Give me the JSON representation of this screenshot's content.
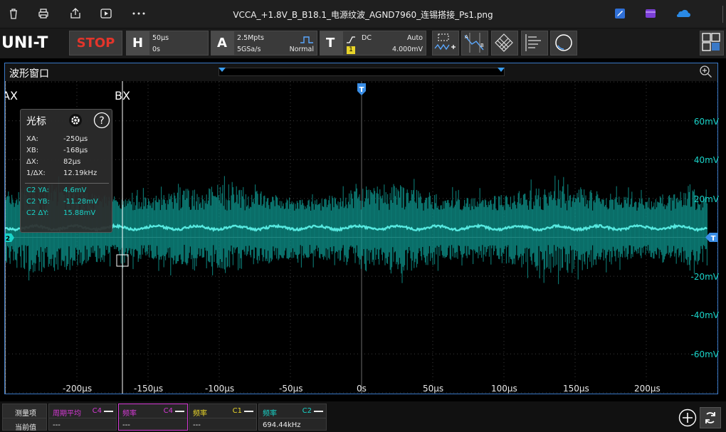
{
  "titlebar": {
    "title": "VCCA_+1.8V_B_B18.1_电源纹波_AGND7960_连锡搭接_Ps1.png",
    "icons": [
      "delete-icon",
      "print-icon",
      "share-icon",
      "slideshow-icon",
      "more-icon",
      "edit-icon",
      "clipchamp-icon",
      "onedrive-icon"
    ]
  },
  "toolbar": {
    "logo": "UNI-T",
    "run_state": "STOP",
    "horizontal": {
      "label": "H",
      "timebase": "50μs",
      "offset": "0s"
    },
    "acquire": {
      "label": "A",
      "points": "2.5Mpts",
      "rate": "5GSa/s",
      "mode": "Normal"
    },
    "trigger": {
      "label": "T",
      "coupling": "DC",
      "sweep": "Auto",
      "source": "1",
      "level": "4.000mV"
    }
  },
  "window": {
    "label": "波形窗口"
  },
  "cursors": {
    "a_label": "AX",
    "b_label": "BX",
    "trigger_marker": "T",
    "channel_marker": "2"
  },
  "cursor_panel": {
    "title": "光标",
    "rows": [
      {
        "k": "XA:",
        "v": "-250μs"
      },
      {
        "k": "XB:",
        "v": "-168μs"
      },
      {
        "k": "ΔX:",
        "v": "82μs"
      },
      {
        "k": "1/ΔX:",
        "v": "12.19kHz"
      }
    ],
    "channel_rows": [
      {
        "k": "C2 YA:",
        "v": "4.6mV"
      },
      {
        "k": "C2 YB:",
        "v": "-11.28mV"
      },
      {
        "k": "C2 ΔY:",
        "v": "15.88mV"
      }
    ]
  },
  "axes": {
    "y_labels": [
      "60mV",
      "40mV",
      "20mV",
      "-20mV",
      "-40mV",
      "-60mV"
    ],
    "x_labels": [
      "-200μs",
      "-150μs",
      "-100μs",
      "-50μs",
      "0s",
      "50μs",
      "100μs",
      "150μs",
      "200μs"
    ]
  },
  "measurements": {
    "header_label": "测量项",
    "current_label": "当前值",
    "items": [
      {
        "name": "周期平均",
        "src": "C4",
        "value": "---",
        "color": "#d43ad4"
      },
      {
        "name": "频率",
        "src": "C4",
        "value": "---",
        "color": "#d43ad4"
      },
      {
        "name": "频率",
        "src": "C1",
        "value": "---",
        "color": "#e8d42a"
      },
      {
        "name": "频率",
        "src": "C2",
        "value": "694.44kHz",
        "color": "#19d3c8"
      }
    ]
  },
  "colors": {
    "ch2": "#19d3c8",
    "ch4": "#d43ad4",
    "ch1": "#e8d42a",
    "accent": "#3a79c7",
    "stop": "#e3352b"
  }
}
